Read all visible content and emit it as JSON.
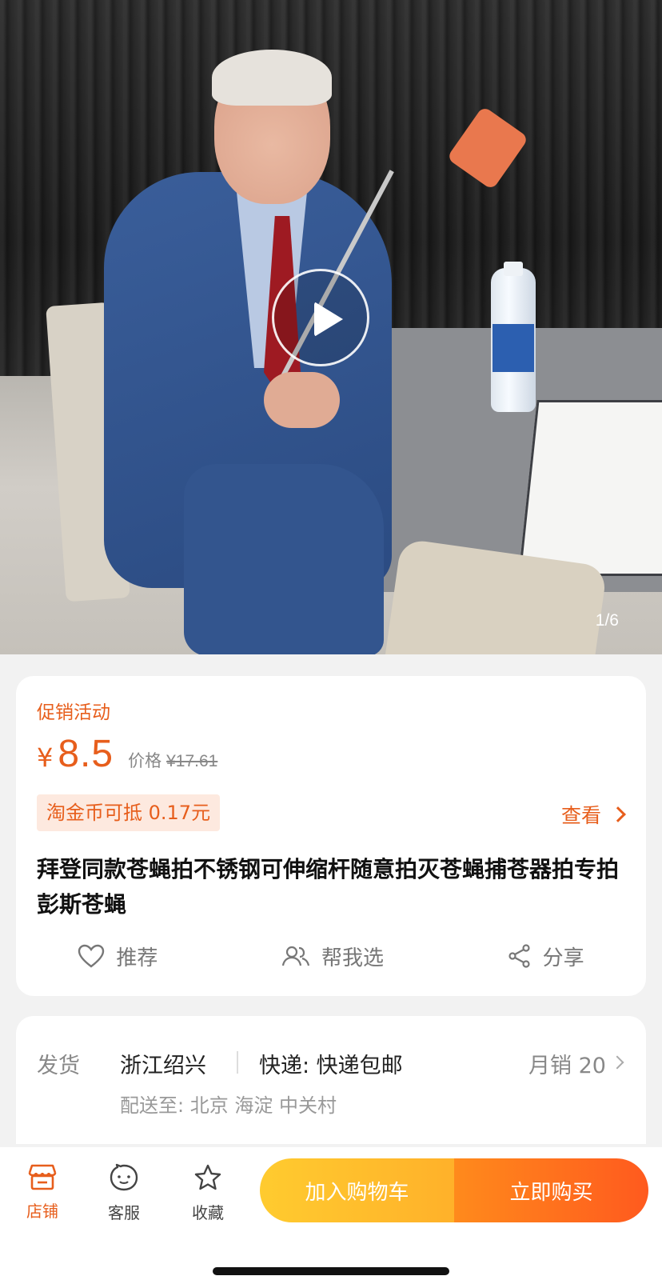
{
  "media": {
    "pager": "1/6"
  },
  "product": {
    "promo_tag": "促销活动",
    "currency": "¥",
    "price": "8.5",
    "orig_label": "价格",
    "orig_price": "¥17.61",
    "coin_badge": "淘金币可抵 0.17元",
    "view_link": "查看",
    "title": "拜登同款苍蝇拍不锈钢可伸缩杆随意拍灭苍蝇捕苍器拍专拍彭斯苍蝇",
    "actions": {
      "recommend": "推荐",
      "help_choose": "帮我选",
      "share": "分享"
    }
  },
  "shipping": {
    "label": "发货",
    "from": "浙江绍兴",
    "express": "快递: 快递包邮",
    "monthly_sales": "月销 20",
    "destination": "配送至: 北京 海淀 中关村"
  },
  "bottom_bar": {
    "shop": "店铺",
    "service": "客服",
    "favorite": "收藏",
    "add_to_cart": "加入购物车",
    "buy_now": "立即购买"
  },
  "colors": {
    "accent": "#e75e1c",
    "cart_gradient": [
      "#ffcb2f",
      "#ffb12a"
    ],
    "buy_gradient": [
      "#ff8a1c",
      "#ff5a1e"
    ]
  }
}
